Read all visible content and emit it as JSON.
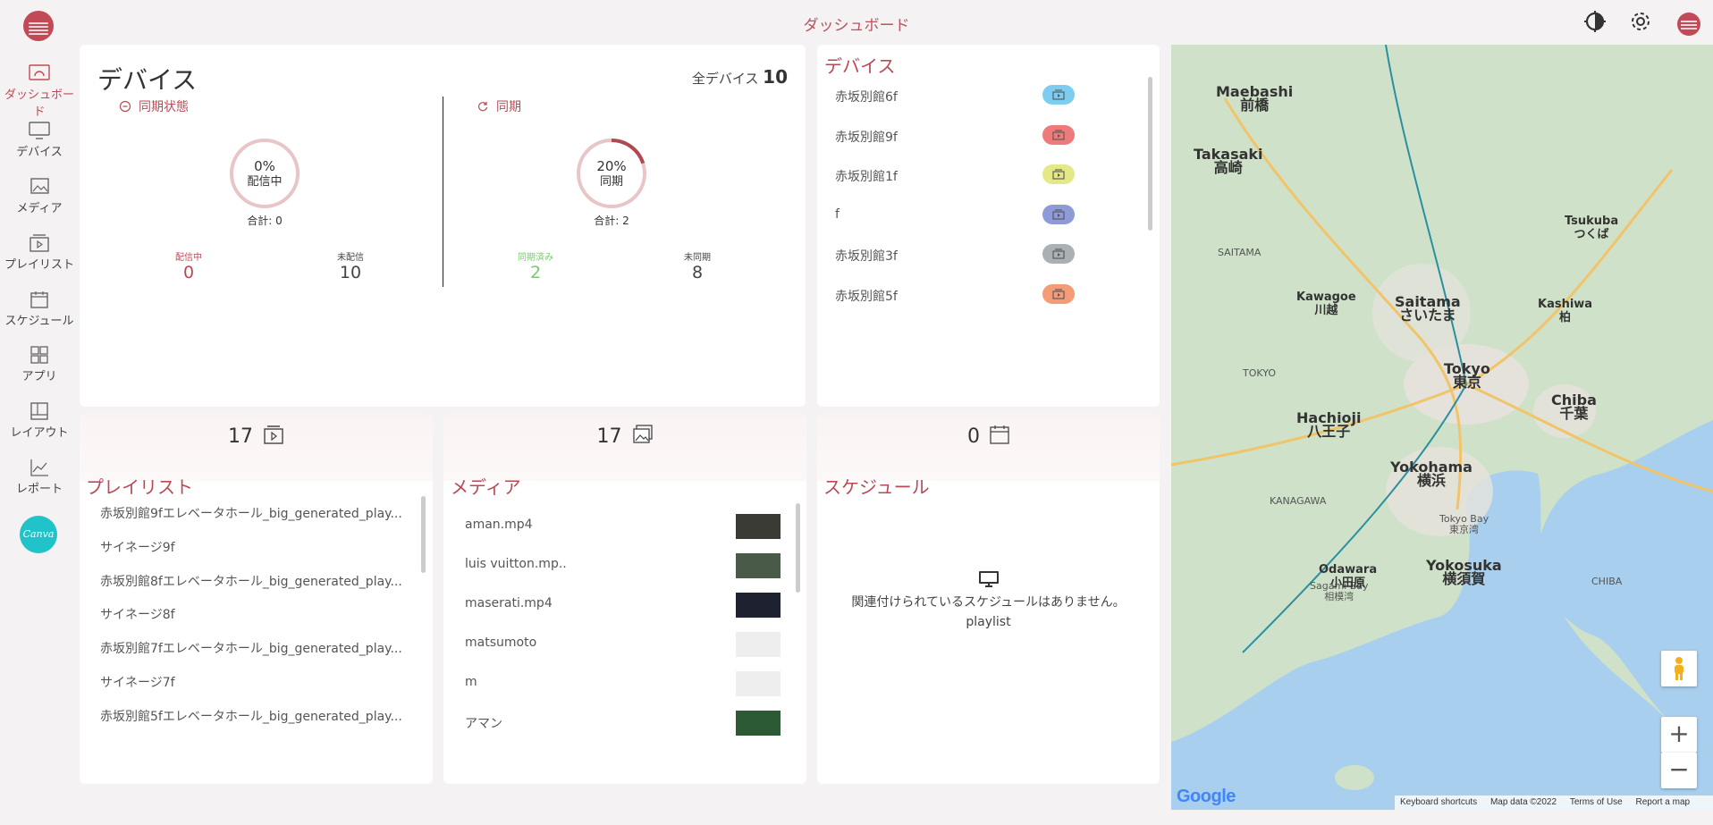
{
  "header": {
    "title": "ダッシュボード"
  },
  "sidebar": {
    "items": [
      {
        "label": "ダッシュボード"
      },
      {
        "label": "デバイス"
      },
      {
        "label": "メディア"
      },
      {
        "label": "プレイリスト"
      },
      {
        "label": "スケジュール"
      },
      {
        "label": "アプリ"
      },
      {
        "label": "レイアウト"
      },
      {
        "label": "レポート"
      }
    ],
    "canva_label": "Canva"
  },
  "device_status": {
    "title": "デバイス",
    "total_label": "全デバイス",
    "total_value": "10",
    "sync_state": {
      "label": "同期状態",
      "percent": "0%",
      "ring_label": "配信中",
      "progress": 0,
      "sum": "合計: 0",
      "stats": [
        {
          "label": "配信中",
          "value": "0",
          "color": "#b94a55"
        },
        {
          "label": "未配信",
          "value": "10",
          "color": "#444444"
        }
      ]
    },
    "sync": {
      "label": "同期",
      "percent": "20%",
      "ring_label": "同期",
      "progress": 0.2,
      "sum": "合計: 2",
      "stats": [
        {
          "label": "同期済み",
          "value": "2",
          "color": "#7ac96f"
        },
        {
          "label": "未同期",
          "value": "8",
          "color": "#444444"
        }
      ]
    }
  },
  "device_list": {
    "title": "デバイス",
    "items": [
      {
        "name": "赤坂別館6f",
        "color": "#7ccdf0"
      },
      {
        "name": "赤坂別館9f",
        "color": "#ee7b7b"
      },
      {
        "name": "赤坂別館1f",
        "color": "#e4e886"
      },
      {
        "name": "f",
        "color": "#8e9bd6"
      },
      {
        "name": "赤坂別館3f",
        "color": "#a9b1b4"
      },
      {
        "name": "赤坂別館5f",
        "color": "#f49b77"
      }
    ]
  },
  "playlist_card": {
    "count": "17",
    "title": "プレイリスト",
    "items": [
      "赤坂別館9fエレベータホール_big_generated_play...",
      "サイネージ9f",
      "赤坂別館8fエレベータホール_big_generated_play...",
      "サイネージ8f",
      "赤坂別館7fエレベータホール_big_generated_play...",
      "サイネージ7f",
      "赤坂別館5fエレベータホール_big_generated_play..."
    ]
  },
  "media_card": {
    "count": "17",
    "title": "メディア",
    "items": [
      {
        "name": "aman.mp4",
        "thumb": "#3b3b36"
      },
      {
        "name": "luis vuitton.mp..",
        "thumb": "#4a5a48"
      },
      {
        "name": "maserati.mp4",
        "thumb": "#1e2230"
      },
      {
        "name": "matsumoto",
        "thumb": "#eeeeee"
      },
      {
        "name": "m",
        "thumb": "#eeeeee"
      },
      {
        "name": "アマン",
        "thumb": "#2c5a35"
      }
    ]
  },
  "schedule_card": {
    "count": "0",
    "title": "スケジュール",
    "empty_message": "関連付けられているスケジュールはありません。",
    "empty_sub": "playlist"
  },
  "map": {
    "labels": [
      {
        "text": "Maebashi\n前橋"
      },
      {
        "text": "Takasaki\n高崎"
      },
      {
        "text": "Saitama\nさいたま"
      },
      {
        "text": "Tokyo\n東京"
      },
      {
        "text": "Chiba\n千葉"
      },
      {
        "text": "Hachioji\n八王子"
      },
      {
        "text": "Yokohama\n横浜"
      },
      {
        "text": "Yokosuka\n横須賀"
      },
      {
        "text": "Kawagoe\n川越"
      },
      {
        "text": "Kashiwa\n柏"
      },
      {
        "text": "SAITAMA"
      },
      {
        "text": "TOKYO"
      },
      {
        "text": "KANAGAWA"
      },
      {
        "text": "CHIBA"
      },
      {
        "text": "Tokyo Bay\n東京湾"
      },
      {
        "text": "Sagami Bay\n相模湾"
      },
      {
        "text": "Odawara\n小田原"
      },
      {
        "text": "Tsukuba\nつくば"
      }
    ],
    "google": "Google",
    "footer": [
      "Keyboard shortcuts",
      "Map data ©2022",
      "Terms of Use",
      "Report a map error"
    ],
    "colors": {
      "land": "#cfe2c9",
      "water": "#a9cfee",
      "city": "#e6e2dc"
    }
  }
}
